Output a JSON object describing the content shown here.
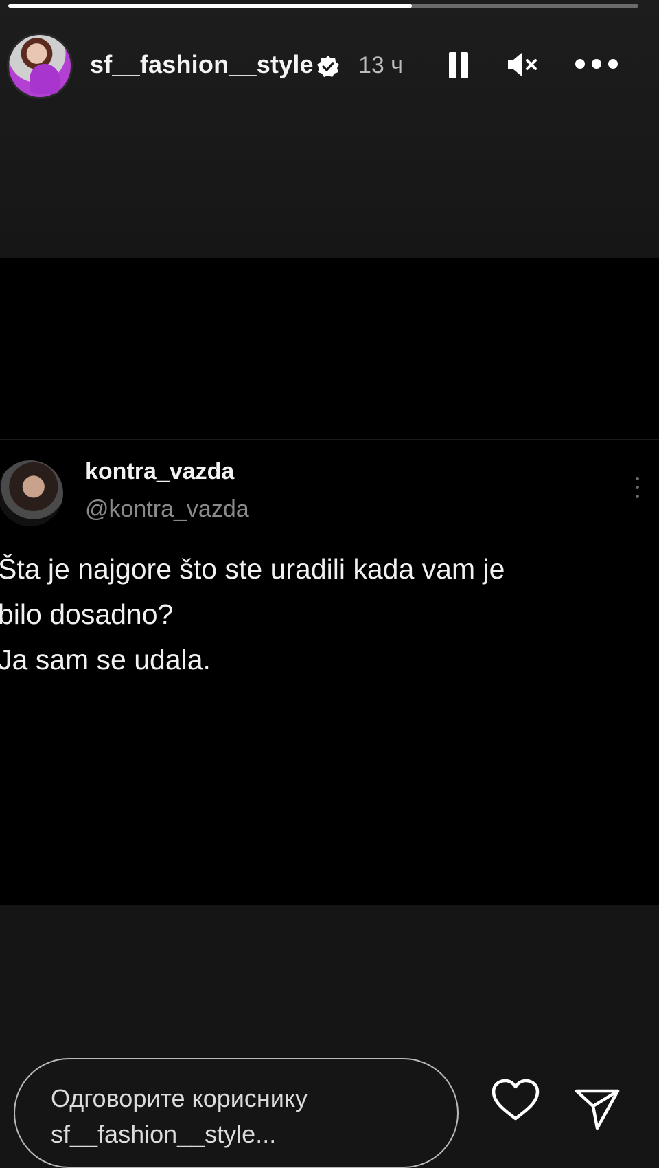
{
  "story": {
    "progress": 0.64,
    "author": {
      "username": "sf__fashion__style",
      "verified": true,
      "posted_ago": "13 ч"
    },
    "controls": {
      "pause_icon": "pause-icon",
      "mute_icon": "speaker-muted-icon",
      "more_icon": "more-horizontal-icon"
    }
  },
  "tweet": {
    "display_name": "kontra_vazda",
    "handle": "@kontra_vazda",
    "lines": [
      "Šta je najgore što ste uradili kada vam je",
      "bilo dosadno?",
      "Ja sam se udala."
    ]
  },
  "reply": {
    "placeholder_line1": "Одговорите кориснику",
    "placeholder_line2": "sf__fashion__style...",
    "like_icon": "heart-icon",
    "send_icon": "send-icon"
  },
  "colors": {
    "background": "#000000",
    "band": "#151515",
    "text_primary": "#f4f4f4",
    "text_secondary": "#8a8a8a"
  }
}
